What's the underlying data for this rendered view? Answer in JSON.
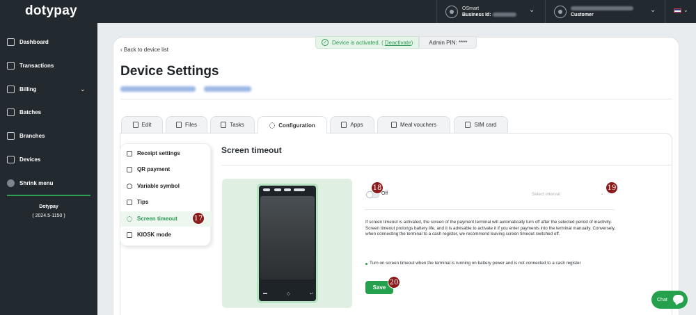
{
  "brand": "dotypay",
  "topbar": {
    "account1": {
      "line1": "OSmart",
      "line2": "Business Id:"
    },
    "account2": {
      "line1": "",
      "line2": "Customer"
    },
    "language_icon": "uk-flag-icon"
  },
  "sidebar": {
    "items": [
      {
        "label": "Dashboard",
        "icon": "grid-icon"
      },
      {
        "label": "Transactions",
        "icon": "list-icon"
      },
      {
        "label": "Billing",
        "icon": "billing-icon"
      },
      {
        "label": "Batches",
        "icon": "batches-icon"
      },
      {
        "label": "Branches",
        "icon": "branches-icon"
      },
      {
        "label": "Devices",
        "icon": "device-icon"
      },
      {
        "label": "Shrink menu",
        "icon": "shrink-icon"
      }
    ],
    "footer_brand": "Dotypay",
    "footer_version": "( 2024.5-1150 )"
  },
  "status": {
    "activated_text": "Device is activated. (",
    "deactivate_link": "Deactivate",
    "activated_close": ")",
    "admin_pin": "Admin PIN: ****"
  },
  "page": {
    "back_link": "Back to device list",
    "title": "Device Settings"
  },
  "tabs": [
    "Edit",
    "Files",
    "Tasks",
    "Configuration",
    "Apps",
    "Meal vouchers",
    "SIM card"
  ],
  "side_menu": [
    "Receipt settings",
    "QR payment",
    "Variable symbol",
    "Tips",
    "Screen timeout",
    "KIOSK mode"
  ],
  "section": {
    "title": "Screen timeout",
    "toggle_label": "Off",
    "select_placeholder": "Select interval",
    "info": "If screen timeout is activated, the screen of the payment terminal will automatically turn off after the selected period of inactivity. Screen timeout prolongs battery life, and it is advisable to activate it if you enter payments into the terminal manually. Conversely, when connecting the terminal to a cash register, we recommend leaving screen timeout switched off.",
    "bullet": "Turn on screen timeout when the terminal is running on battery power and is not connected to a cash register",
    "save_label": "Save"
  },
  "badges": {
    "b17": "17",
    "b18": "18",
    "b19": "19",
    "b20": "20"
  },
  "chat_label": "Chat",
  "colors": {
    "accent": "#25a04d",
    "sidebar_bg": "#22292f",
    "badge": "#8b1a1a"
  }
}
